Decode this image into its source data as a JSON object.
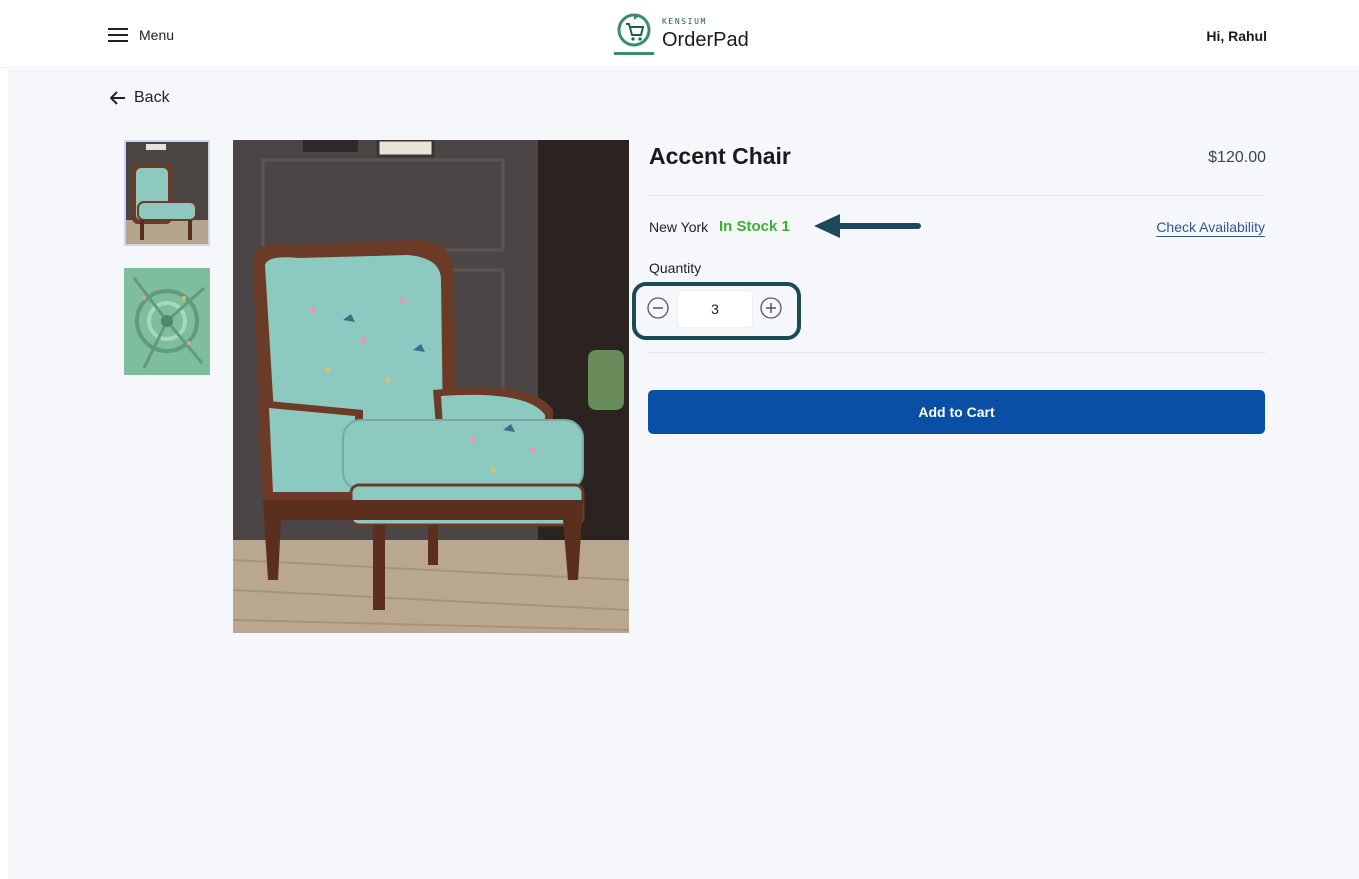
{
  "header": {
    "menu_label": "Menu",
    "logo_small": "KENSIUM",
    "logo_name": "OrderPad",
    "greeting": "Hi, Rahul"
  },
  "nav": {
    "back_label": "Back"
  },
  "product": {
    "title": "Accent Chair",
    "price": "$120.00",
    "location": "New York",
    "stock_text": "In Stock 1",
    "check_availability": "Check Availability",
    "quantity_label": "Quantity",
    "quantity_value": "3",
    "add_to_cart": "Add to Cart"
  },
  "icons": {
    "menu": "hamburger-menu-icon",
    "back": "arrow-left-icon",
    "minus": "minus-circle-icon",
    "plus": "plus-circle-icon",
    "logo": "cart-logo-icon"
  },
  "colors": {
    "accent": "#0a4fa6",
    "in_stock": "#38b12e",
    "link": "#2c5a8c",
    "annotation": "#1b4a58",
    "logo_green": "#3a8d6b"
  }
}
